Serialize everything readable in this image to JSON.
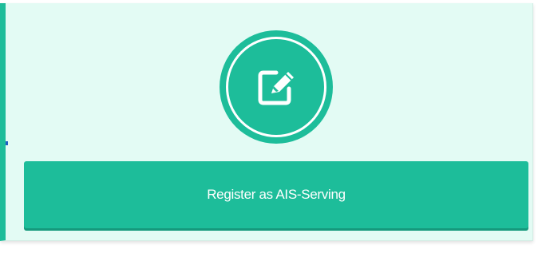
{
  "register_card": {
    "icon": "edit-icon",
    "button_label": "Register as AIS-Serving"
  },
  "colors": {
    "accent": "#1dbd9a",
    "card_background": "#e3fbf4",
    "button_text": "#ffffff"
  }
}
